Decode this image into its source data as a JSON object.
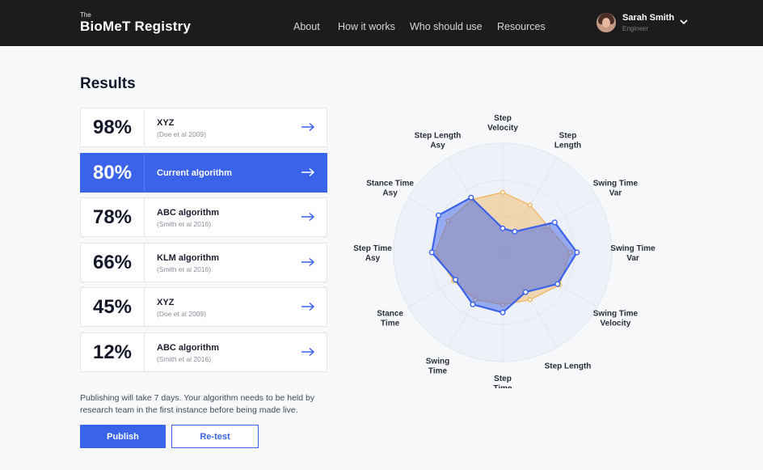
{
  "header": {
    "logo_small": "The",
    "logo_main": "BioMeT Registry",
    "nav": [
      {
        "label": "About"
      },
      {
        "label": "How it works"
      },
      {
        "label": "Who should use"
      },
      {
        "label": "Resources"
      }
    ],
    "user": {
      "name": "Sarah Smith",
      "role": "Engineer"
    }
  },
  "results": {
    "title": "Results",
    "rows": [
      {
        "percent": "98%",
        "name": "XYZ",
        "citation": "(Doe et al 2009)",
        "active": false
      },
      {
        "percent": "80%",
        "name": "Current algorithm",
        "citation": "",
        "active": true
      },
      {
        "percent": "78%",
        "name": "ABC algorithm",
        "citation": "(Smith et al 2016)",
        "active": false
      },
      {
        "percent": "66%",
        "name": "KLM algorithm",
        "citation": "(Smith et al 2016)",
        "active": false
      },
      {
        "percent": "45%",
        "name": "XYZ",
        "citation": "(Doe et al 2009)",
        "active": false
      },
      {
        "percent": "12%",
        "name": "ABC algorithm",
        "citation": "(Smith et al 2016)",
        "active": false
      }
    ]
  },
  "footer": {
    "note": "Publishing will take 7 days. Your algorithm needs to be held by research team in the first instance before being made live.",
    "publish_label": "Publish",
    "retest_label": "Re-test"
  },
  "chart_data": {
    "type": "radar",
    "axes": [
      [
        "Step",
        "Velocity"
      ],
      [
        "Step",
        "Length"
      ],
      [
        "Swing Time",
        "Var"
      ],
      [
        "Swing Time",
        "Var"
      ],
      [
        "Swing Time",
        "Velocity"
      ],
      [
        "Step Length"
      ],
      [
        "Step",
        "Time"
      ],
      [
        "Swing",
        "Time"
      ],
      [
        "Stance",
        "Time"
      ],
      [
        "Step Time",
        "Asy"
      ],
      [
        "Stance Time",
        "Asy"
      ],
      [
        "Step Length",
        "Asy"
      ]
    ],
    "range": [
      0,
      1
    ],
    "series": [
      {
        "values": [
          0.55,
          0.5,
          0.48,
          0.62,
          0.6,
          0.5,
          0.48,
          0.5,
          0.52,
          0.62,
          0.58,
          0.56
        ],
        "color": "#f2b45c"
      },
      {
        "values": [
          0.22,
          0.22,
          0.55,
          0.68,
          0.58,
          0.42,
          0.55,
          0.55,
          0.5,
          0.65,
          0.68,
          0.58
        ],
        "color": "#3b63ea"
      }
    ],
    "colors": {
      "grid": "#e1e6f0",
      "background": "#eef1f7"
    }
  }
}
